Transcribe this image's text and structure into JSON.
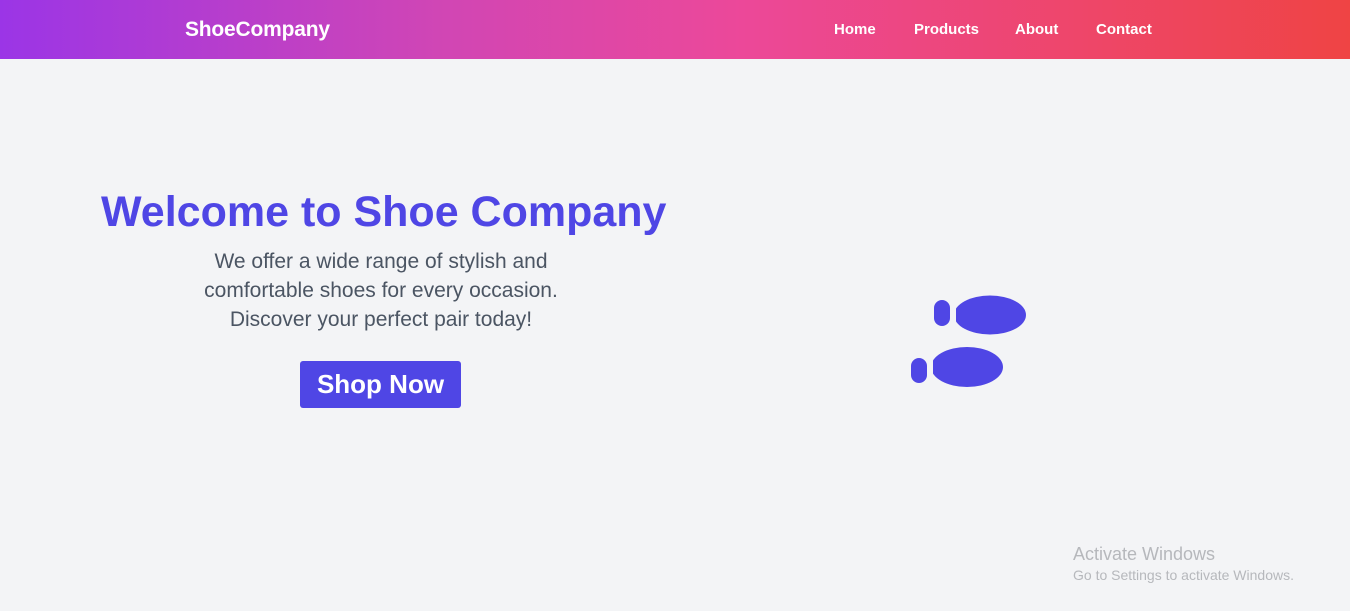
{
  "navbar": {
    "brand": "ShoeCompany",
    "links": [
      {
        "label": "Home"
      },
      {
        "label": "Products"
      },
      {
        "label": "About"
      },
      {
        "label": "Contact"
      }
    ]
  },
  "hero": {
    "title": "Welcome to Shoe Company",
    "description": "We offer a wide range of stylish and comfortable shoes for every occasion. Discover your perfect pair today!",
    "cta_label": "Shop Now",
    "illustration_icon": "footprints-icon"
  },
  "watermark": {
    "title": "Activate Windows",
    "subtitle": "Go to Settings to activate Windows."
  },
  "colors": {
    "accent": "#4f46e5",
    "background": "#f3f4f6",
    "gradient_start": "#9b35e6",
    "gradient_mid": "#ec4899",
    "gradient_end": "#ef4444",
    "body_text": "#4b5563"
  }
}
